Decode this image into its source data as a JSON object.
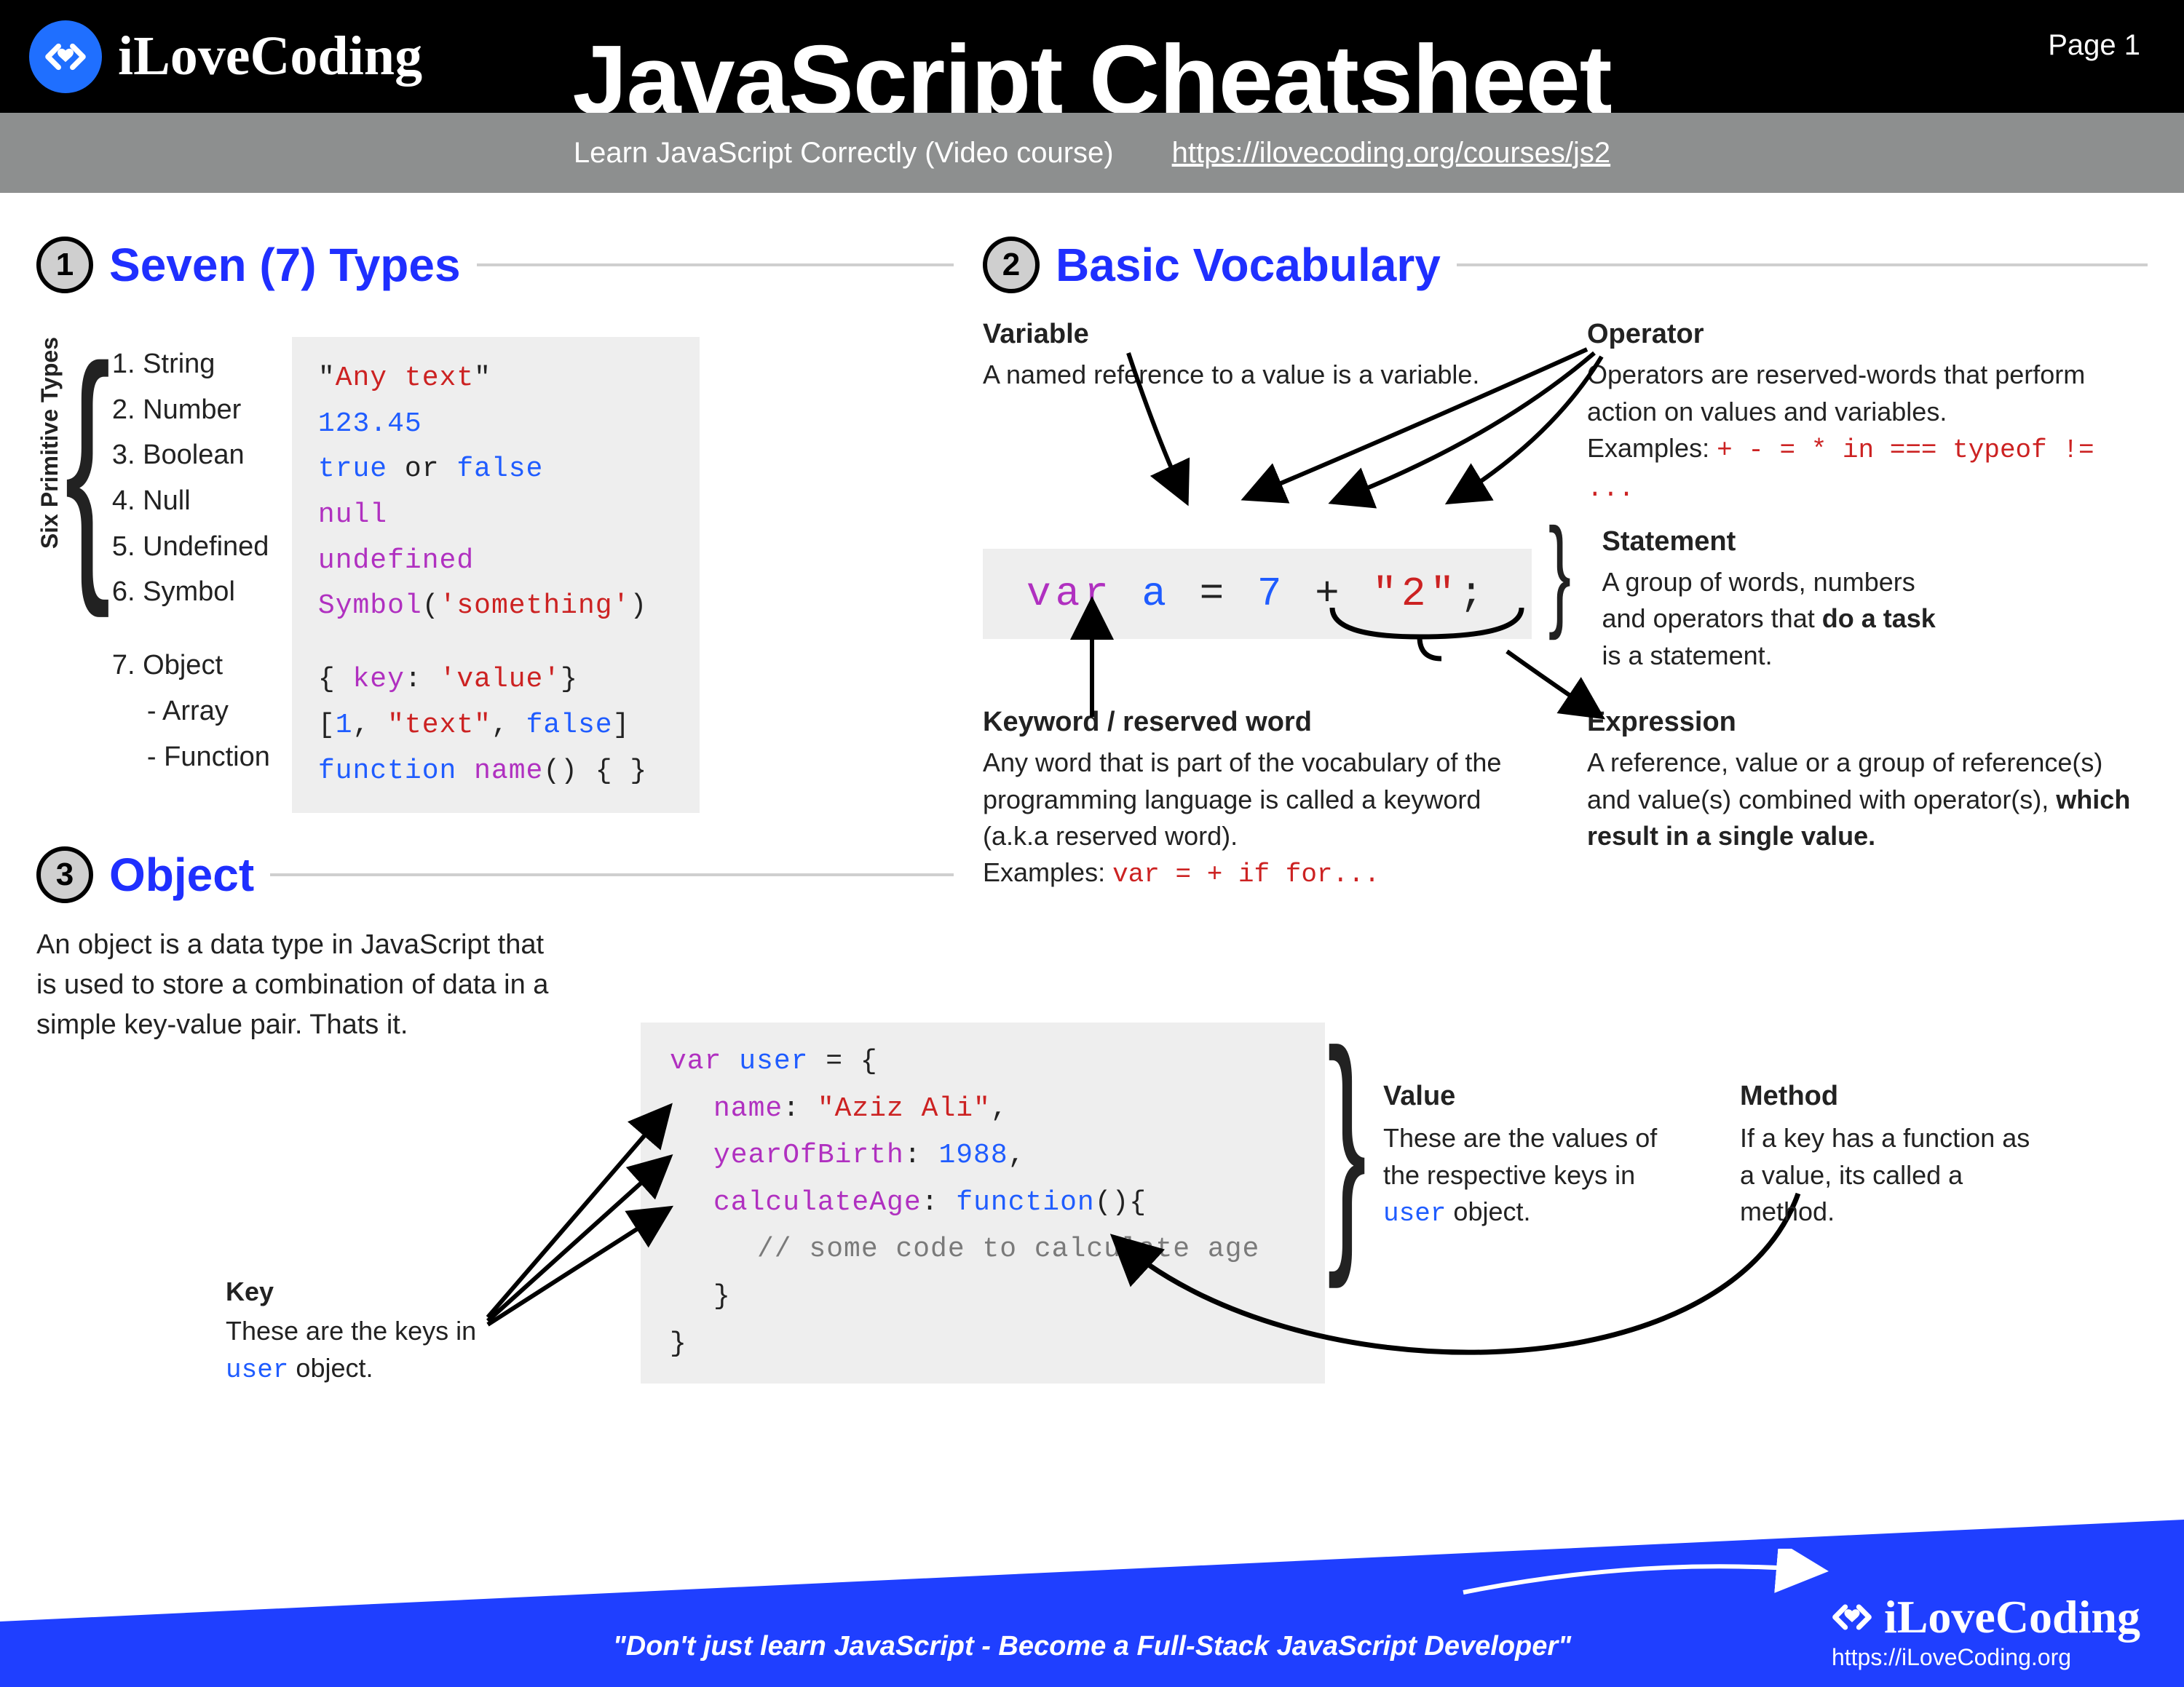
{
  "header": {
    "brand": "iLoveCoding",
    "title": "JavaScript Cheatsheet",
    "page": "Page 1",
    "subtitle": "Learn JavaScript Correctly (Video course)",
    "link": "https://ilovecoding.org/courses/js2"
  },
  "sec1": {
    "num": "1",
    "title": "Seven (7) Types",
    "primitive_label": "Six Primitive Types",
    "items": {
      "i1": "1.  String",
      "i2": "2.  Number",
      "i3": "3.  Boolean",
      "i4": "4.  Null",
      "i5": "5.  Undefined",
      "i6": "6.  Symbol",
      "i7": "7.  Object",
      "i7a": "-  Array",
      "i7b": "-  Function"
    },
    "code": {
      "c1a": "\"",
      "c1b": "Any text",
      "c1c": "\"",
      "c2": "123.45",
      "c3a": "true",
      "c3b": "or",
      "c3c": "false",
      "c4": "null",
      "c5": "undefined",
      "c6a": "Symbol",
      "c6b": "(",
      "c6c": "'something'",
      "c6d": ")",
      "c7a": "{ ",
      "c7b": "key",
      "c7c": ": ",
      "c7d": "'value'",
      "c7e": "}",
      "c8a": "[",
      "c8b": "1",
      "c8c": ", ",
      "c8d": "\"text\"",
      "c8e": ", ",
      "c8f": "false",
      "c8g": "]",
      "c9a": "function ",
      "c9b": "name",
      "c9c": "() { }"
    }
  },
  "sec2": {
    "num": "2",
    "title": "Basic Vocabulary",
    "variable": {
      "h": "Variable",
      "t": "A named reference to a value is a variable."
    },
    "operator": {
      "h": "Operator",
      "t": "Operators are reserved-words that perform action on values and variables.",
      "ex_label": "Examples: ",
      "ex_ops": "+ - = * in === typeof != ..."
    },
    "code": {
      "p1": "var ",
      "p2": "a ",
      "p3": "= ",
      "p4": "7 ",
      "p5": "+ ",
      "p6": "\"2\"",
      "p7": ";"
    },
    "statement": {
      "h": "Statement",
      "t1": "A group of words, numbers and operators that ",
      "t2": "do a task",
      "t3": " is a statement."
    },
    "keyword": {
      "h": "Keyword / reserved word",
      "t": "Any word that is part of the vocabulary of the programming language is called a keyword (a.k.a reserved word).",
      "ex_label": "Examples: ",
      "ex_ops": "var = + if for..."
    },
    "expression": {
      "h": "Expression",
      "t1": "A reference, value or a group of reference(s) and value(s) combined with operator(s), ",
      "t2": "which result in a single value."
    }
  },
  "sec3": {
    "num": "3",
    "title": "Object",
    "desc": "An object is a data type in JavaScript that is used to store a combination of data in a simple key-value pair. Thats it.",
    "code": {
      "l1a": "var ",
      "l1b": "user ",
      "l1c": "= {",
      "l2a": "name",
      "l2b": ": ",
      "l2c": "\"Aziz Ali\"",
      "l2d": ",",
      "l3a": "yearOfBirth",
      "l3b": ": ",
      "l3c": "1988",
      "l3d": ",",
      "l4a": "calculateAge",
      "l4b": ": ",
      "l4c": "function",
      "l4d": "(){",
      "l5": "// some code to calculate age",
      "l6": "}",
      "l7": "}"
    },
    "key_call": {
      "h": "Key",
      "t1": "These are the keys in ",
      "t2": "user",
      "t3": " object."
    },
    "value_call": {
      "h": "Value",
      "t1": "These are the values of the respective keys in ",
      "t2": "user",
      "t3": " object."
    },
    "method_call": {
      "h": "Method",
      "t": "If a key has a function as a value, its called a method."
    }
  },
  "footer": {
    "quote": "\"Don't just learn JavaScript - Become a Full-Stack JavaScript Developer\"",
    "brand": "iLoveCoding",
    "url": "https://iLoveCoding.org"
  }
}
